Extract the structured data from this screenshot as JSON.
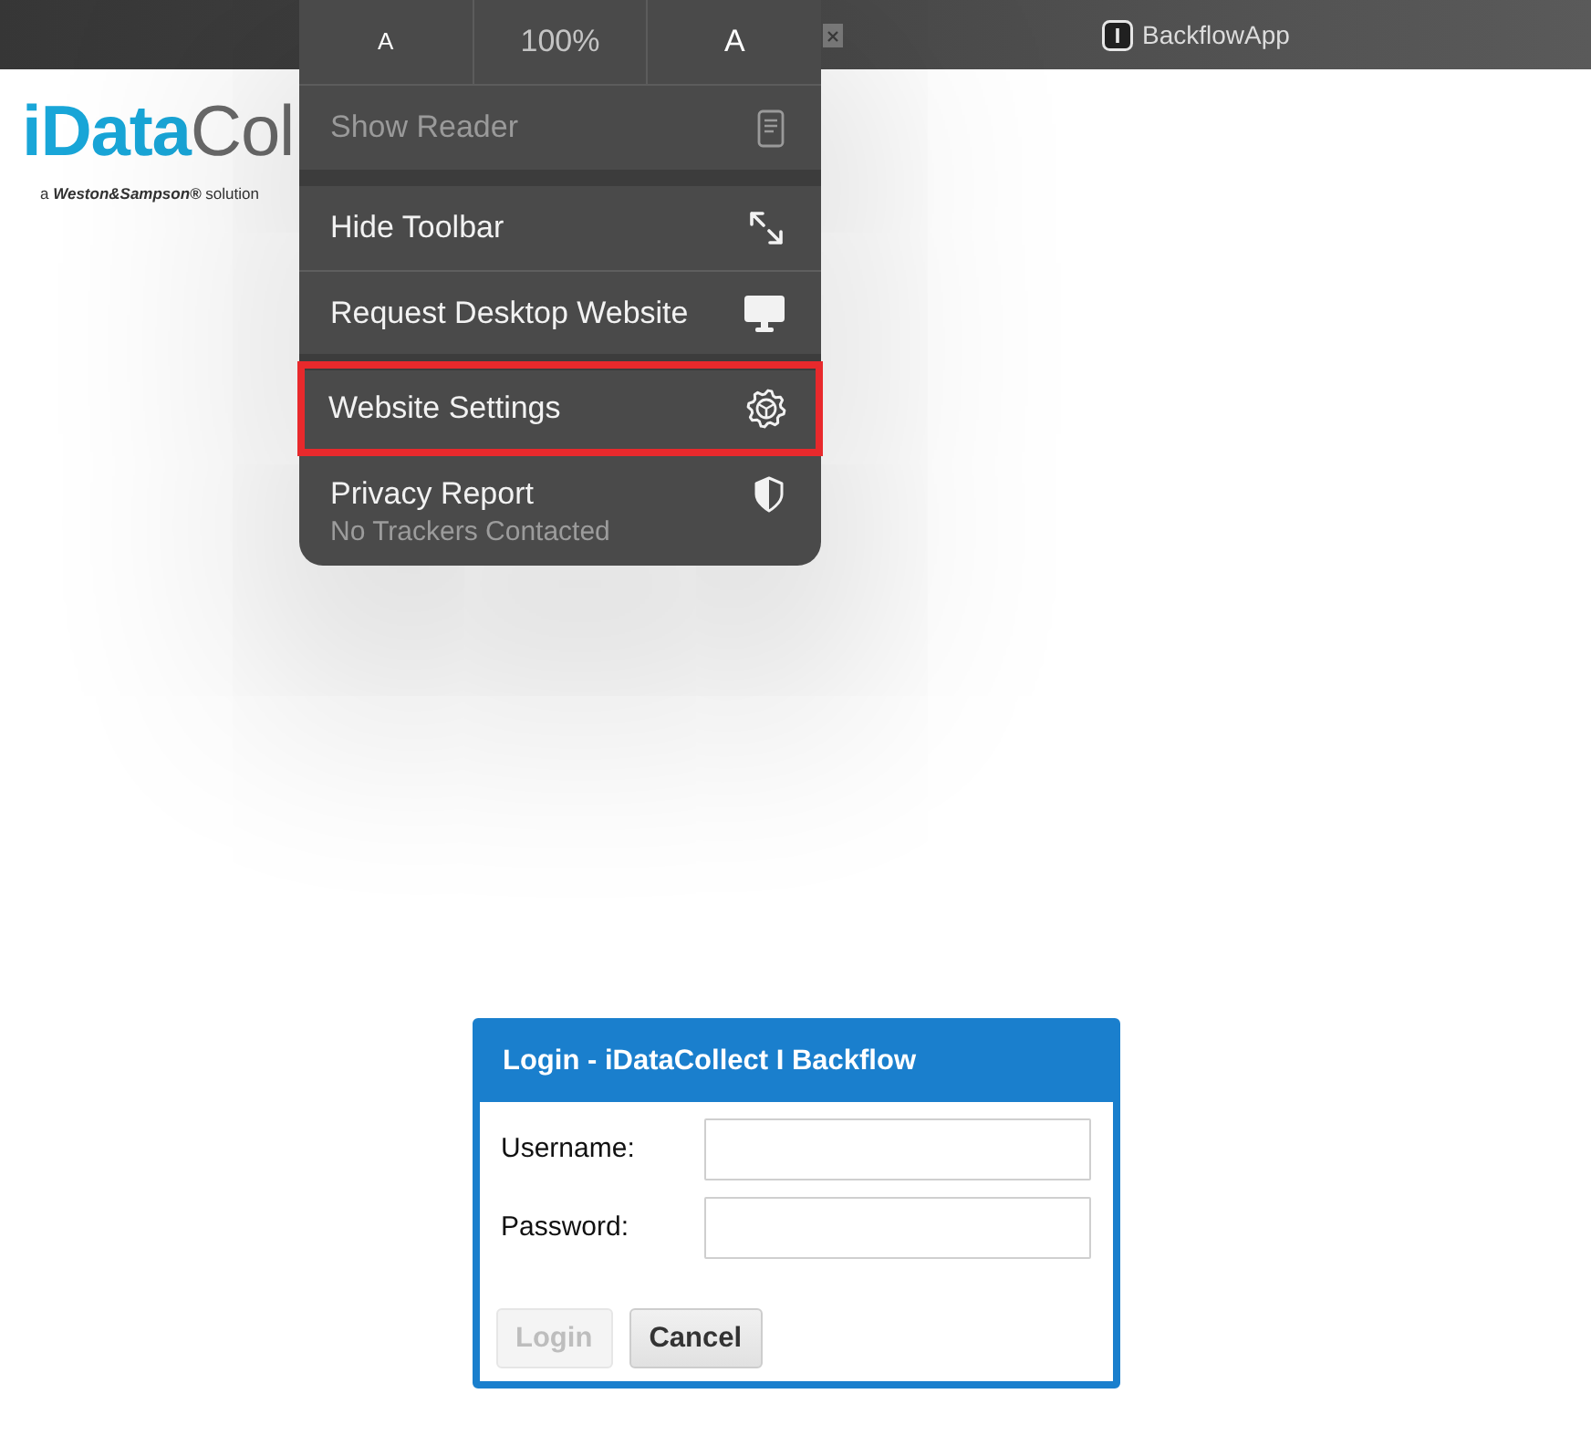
{
  "browser_bar": {
    "tab_title": "BackflowApp"
  },
  "page": {
    "logo": {
      "wordmark": "**iData**Col",
      "tagline": "a **Weston&Sampson®** solution"
    },
    "login_dialog": {
      "title": "Login - iDataCollect I Backflow",
      "fields": [
        {
          "label": "Username:"
        },
        {
          "label": "Password:"
        }
      ],
      "buttons": [
        {
          "label": "Login",
          "disabled": true
        },
        {
          "label": "Cancel",
          "disabled": false
        }
      ]
    }
  },
  "menu": {
    "text_size": [
      {
        "kind": "smaller",
        "label": "A"
      },
      {
        "kind": "zoom",
        "label": "100%"
      },
      {
        "kind": "larger",
        "label": "A"
      }
    ],
    "groups": [
      {
        "items": [
          {
            "label": "Show Reader",
            "disabled": true,
            "highlighted": false
          }
        ]
      },
      {
        "items": [
          {
            "label": "Hide Toolbar",
            "disabled": false,
            "highlighted": false
          },
          {
            "label": "Request Desktop Website",
            "disabled": false,
            "highlighted": false
          }
        ]
      },
      {
        "items": [
          {
            "label": "Website Settings",
            "disabled": false,
            "highlighted": true
          },
          {
            "label": "Privacy Report",
            "subtitle": "No Trackers Contacted",
            "disabled": false,
            "highlighted": false
          }
        ]
      }
    ]
  }
}
